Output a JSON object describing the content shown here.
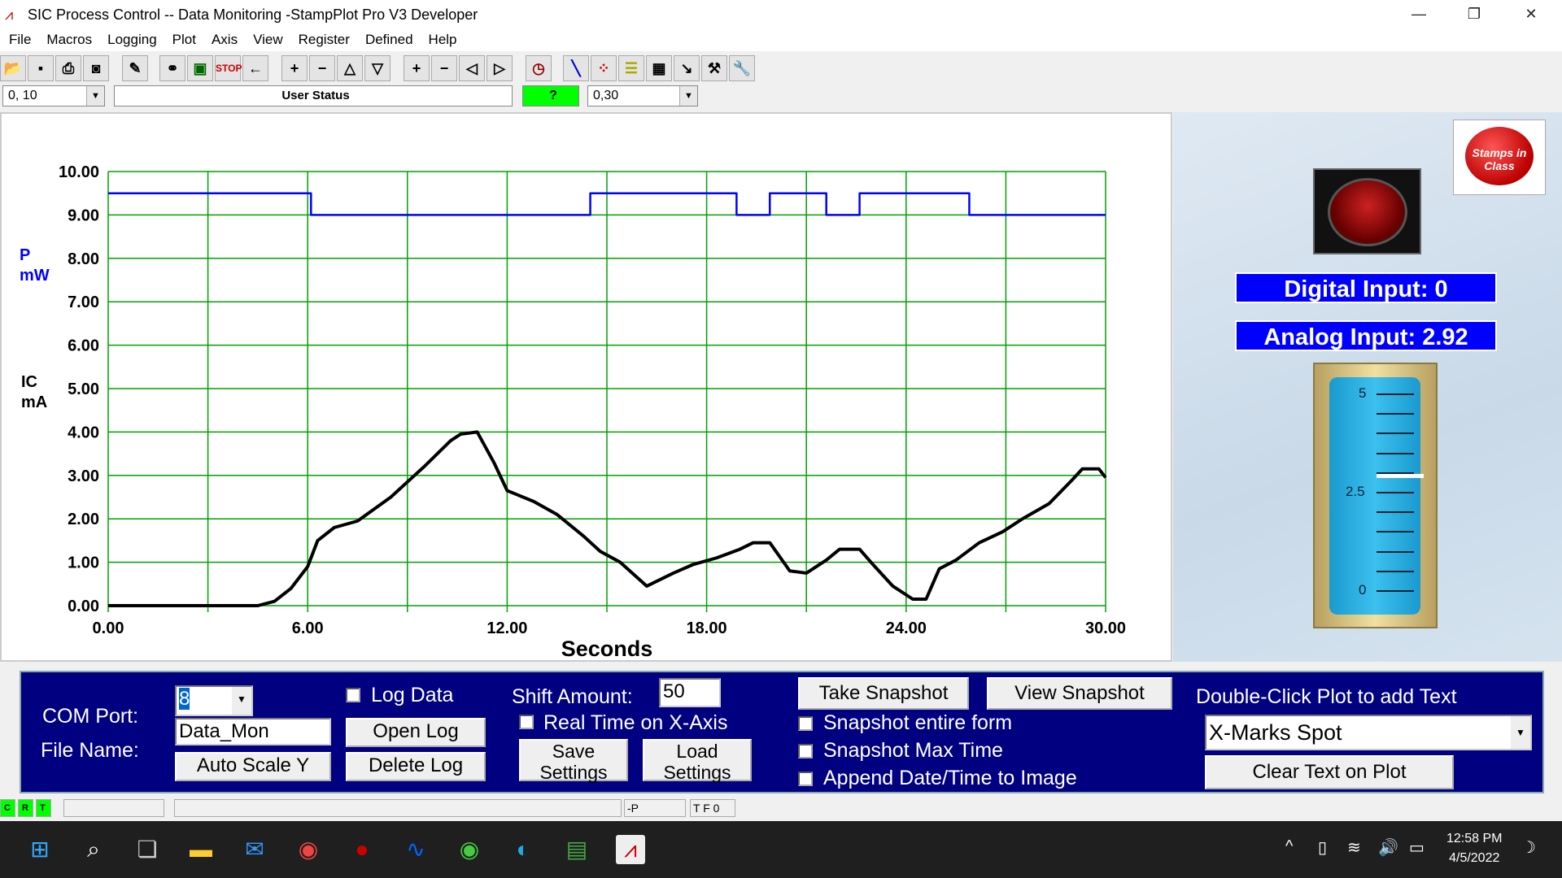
{
  "window": {
    "title": "SIC Process Control -- Data Monitoring  -StampPlot Pro V3 Developer",
    "controls": [
      "minimize",
      "restore",
      "close"
    ]
  },
  "menu": [
    "File",
    "Macros",
    "Logging",
    "Plot",
    "Axis",
    "View",
    "Register",
    "Defined",
    "Help"
  ],
  "toolbar": [
    "open-folder",
    "save",
    "print",
    "camera",
    "wand",
    "connect",
    "plot-monitor",
    "stop",
    "back-arrow",
    "plus",
    "minus",
    "scale-up",
    "scale-down",
    "plus",
    "minus",
    "shift-left",
    "shift-right",
    "clock",
    "pen",
    "plot-dots",
    "notes",
    "calculator",
    "probe",
    "tool-box",
    "wrench"
  ],
  "statusrow": {
    "y_range": "0, 10",
    "user_status": "User Status",
    "indicator": "?",
    "x_range": "0,30",
    "indicator_color": "#00ff00"
  },
  "chart_data": {
    "type": "line",
    "xlabel": "Seconds",
    "ylabels": [
      {
        "text": "P\nmW",
        "color": "#0000ff"
      },
      {
        "text": "IC\nmA",
        "color": "#000000"
      }
    ],
    "xlim": [
      0,
      30
    ],
    "ylim": [
      0,
      10
    ],
    "xticks": [
      "0.00",
      "6.00",
      "12.00",
      "18.00",
      "24.00",
      "30.00"
    ],
    "yticks": [
      "0.00",
      "1.00",
      "2.00",
      "3.00",
      "4.00",
      "5.00",
      "6.00",
      "7.00",
      "8.00",
      "9.00",
      "10.00"
    ],
    "grid": true,
    "grid_color": "#00a000",
    "series": [
      {
        "color": "#0000ff",
        "step": true,
        "x": [
          0,
          6.1,
          14.5,
          18.9,
          19.9,
          21.6,
          22.6,
          25.9,
          30
        ],
        "y": [
          9.5,
          9.0,
          9.5,
          9.0,
          9.5,
          9.0,
          9.5,
          9.0,
          9.0
        ]
      },
      {
        "color": "#000000",
        "step": false,
        "x": [
          0,
          4.5,
          5,
          5.5,
          6,
          6.3,
          6.8,
          7.5,
          8.5,
          9.5,
          10.3,
          10.6,
          11.1,
          11.6,
          12,
          12.8,
          13.5,
          14.3,
          14.8,
          15.4,
          16.2,
          17,
          17.6,
          18.3,
          19,
          19.4,
          19.9,
          20.5,
          21,
          21.6,
          22,
          22.6,
          23,
          23.6,
          24.2,
          24.6,
          25,
          25.5,
          26.2,
          26.9,
          27.5,
          28.3,
          29,
          29.3,
          29.8,
          30
        ],
        "y": [
          0,
          0,
          0.1,
          0.4,
          0.9,
          1.5,
          1.8,
          1.95,
          2.5,
          3.2,
          3.8,
          3.95,
          4.0,
          3.3,
          2.65,
          2.4,
          2.1,
          1.6,
          1.25,
          1.0,
          0.45,
          0.75,
          0.95,
          1.1,
          1.3,
          1.45,
          1.45,
          0.8,
          0.75,
          1.05,
          1.3,
          1.3,
          0.95,
          0.45,
          0.15,
          0.15,
          0.85,
          1.05,
          1.45,
          1.7,
          2.0,
          2.35,
          2.9,
          3.15,
          3.15,
          2.95
        ]
      }
    ]
  },
  "right": {
    "digital_input": "Digital Input: 0",
    "analog_input": "Analog Input: 2.92",
    "gauge": {
      "min": 0,
      "max": 5,
      "labels": [
        "5",
        "2.5",
        "0"
      ],
      "value": 2.92
    },
    "logo_text": "Stamps in Class"
  },
  "controls": {
    "com_port_label": "COM Port:",
    "com_port": "8",
    "file_name_label": "File Name:",
    "file_name": "Data_Mon",
    "auto_scale": "Auto Scale Y",
    "log_data": "Log Data",
    "open_log": "Open Log",
    "delete_log": "Delete Log",
    "shift_label": "Shift Amount:",
    "shift": "50",
    "real_time": "Real Time on X-Axis",
    "save_settings": "Save\nSettings",
    "load_settings": "Load\nSettings",
    "take_snapshot": "Take Snapshot",
    "view_snapshot": "View Snapshot",
    "snap_entire": "Snapshot entire form",
    "snap_max": "Snapshot Max Time",
    "append_date": "Append Date/Time to Image",
    "dbl_click": "Double-Click Plot to add Text",
    "text_select": "X-Marks Spot",
    "clear_text": "Clear Text on Plot"
  },
  "statusbar": {
    "c": "C",
    "r": "R",
    "t": "T",
    "p": "-P",
    "tf": "T F 0"
  },
  "taskbar": {
    "time": "12:58 PM",
    "date": "4/5/2022"
  }
}
